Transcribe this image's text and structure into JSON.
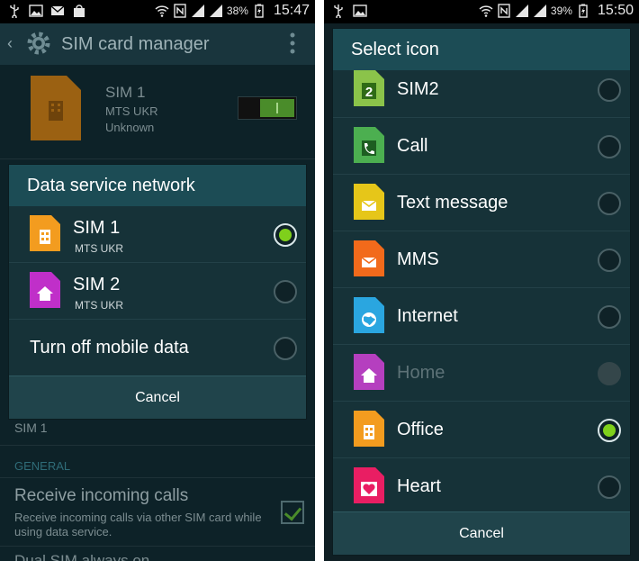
{
  "left": {
    "status": {
      "battery": "38%",
      "time": "15:47"
    },
    "appbar": {
      "title": "SIM card manager"
    },
    "background": {
      "sim_name": "SIM 1",
      "sim_operator": "MTS UKR",
      "sim_number": "Unknown",
      "row_value": "SIM 1",
      "section": "GENERAL",
      "receive_title": "Receive incoming calls",
      "receive_desc": "Receive incoming calls via other SIM card while using data service.",
      "partial_row": "Dual SIM always on"
    },
    "dialog": {
      "title": "Data service network",
      "items": [
        {
          "label": "SIM 1",
          "sub": "MTS UKR",
          "icon": "sim-office-orange",
          "selected": true
        },
        {
          "label": "SIM 2",
          "sub": "MTS UKR",
          "icon": "sim-home-purple",
          "selected": false
        },
        {
          "label": "Turn off mobile data",
          "selected": false
        }
      ],
      "cancel": "Cancel"
    }
  },
  "right": {
    "status": {
      "battery": "39%",
      "time": "15:50"
    },
    "dialog": {
      "title": "Select icon",
      "items": [
        {
          "label": "SIM2",
          "icon": "sim2-icon",
          "color": "#8bc34a",
          "selected": false
        },
        {
          "label": "Call",
          "icon": "call-icon",
          "color": "#4caf50",
          "selected": false
        },
        {
          "label": "Text message",
          "icon": "message-icon",
          "color": "#e6c619",
          "selected": false
        },
        {
          "label": "MMS",
          "icon": "mms-icon",
          "color": "#f26a1b",
          "selected": false
        },
        {
          "label": "Internet",
          "icon": "internet-icon",
          "color": "#2aa6e0",
          "selected": false
        },
        {
          "label": "Home",
          "icon": "home-icon",
          "color": "#b53fbf",
          "selected": false,
          "disabled": true
        },
        {
          "label": "Office",
          "icon": "office-icon",
          "color": "#f39c1f",
          "selected": true
        },
        {
          "label": "Heart",
          "icon": "heart-icon",
          "color": "#e91e63",
          "selected": false
        }
      ],
      "cancel": "Cancel"
    }
  }
}
